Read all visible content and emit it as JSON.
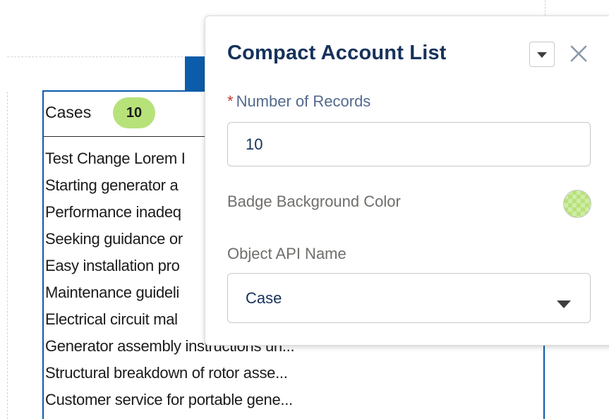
{
  "cases_card": {
    "title": "Cases",
    "badge_count": "10",
    "items": [
      "Test Change Lorem I",
      "Starting generator a",
      "Performance inadeq",
      "Seeking guidance or",
      "Easy installation pro",
      "Maintenance guideli",
      "Electrical circuit mal",
      "Generator assembly instructions un...",
      "Structural breakdown of rotor asse...",
      "Customer service for portable gene..."
    ]
  },
  "property_panel": {
    "title": "Compact Account List",
    "icons": {
      "menu": "chevron-down-icon",
      "close": "close-icon"
    },
    "fields": {
      "number_of_records": {
        "required_marker": "*",
        "label": "Number of Records",
        "value": "10"
      },
      "badge_background_color": {
        "label": "Badge Background Color",
        "value_color": "#b7e27a"
      },
      "object_api_name": {
        "label": "Object API Name",
        "value": "Case"
      }
    }
  },
  "colors": {
    "selection_blue": "#0b5cab",
    "title_navy": "#16325c",
    "badge_green": "#b7e27a",
    "required_red": "#c23934"
  }
}
